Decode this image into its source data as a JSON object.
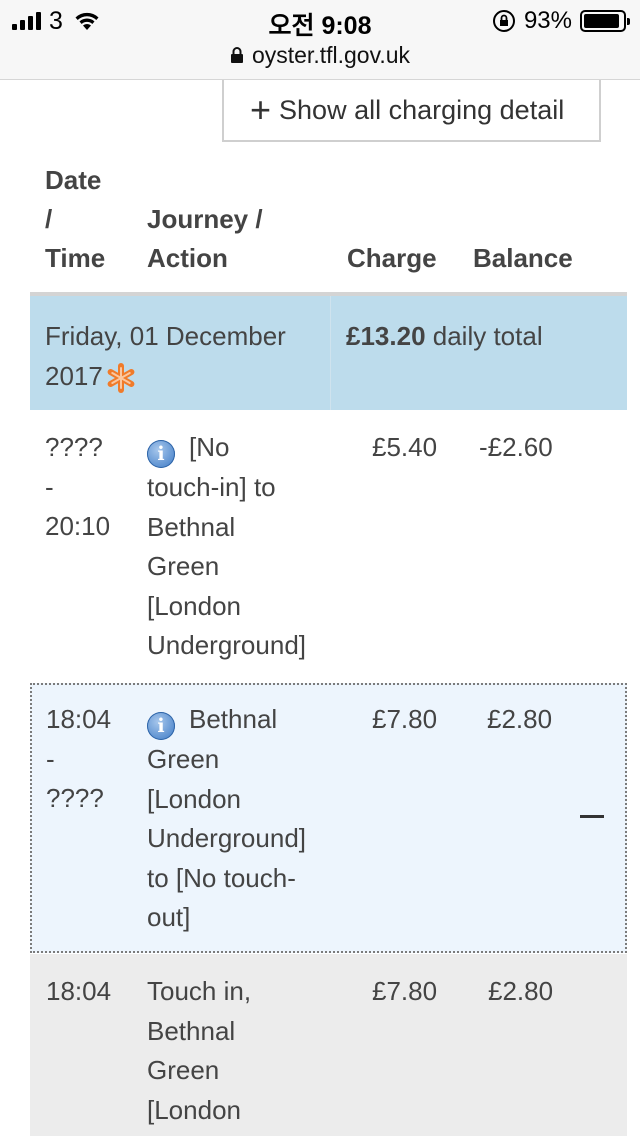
{
  "status_bar": {
    "carrier": "3",
    "time": "오전 9:08",
    "battery_percent": "93%",
    "battery_level": 0.93,
    "url": "oyster.tfl.gov.uk"
  },
  "show_all_button": {
    "label": "Show all charging detail"
  },
  "table_headers": {
    "date_time": [
      "Date",
      "/",
      "Time"
    ],
    "journey": [
      "Journey /",
      "Action"
    ],
    "charge": "Charge",
    "balance": "Balance"
  },
  "day": {
    "date_lines": [
      "Friday, 01 December",
      "2017"
    ],
    "total_amount": "£13.20",
    "total_suffix": " daily total"
  },
  "rows": [
    {
      "time_lines": [
        "????",
        "-",
        "20:10"
      ],
      "journey_lines": [
        "[No",
        "touch-in] to",
        "Bethnal",
        "Green",
        "[London",
        "Underground]"
      ],
      "charge": "£5.40",
      "balance": "-£2.60"
    },
    {
      "time_lines": [
        "18:04",
        "-",
        "????"
      ],
      "journey_lines": [
        "Bethnal",
        "Green",
        "[London",
        "Underground]",
        "to [No touch-",
        "out]"
      ],
      "charge": "£7.80",
      "balance": "£2.80"
    },
    {
      "time_lines": [
        "18:04"
      ],
      "journey_lines": [
        "Touch in,",
        "Bethnal",
        "Green",
        "[London"
      ],
      "charge": "£7.80",
      "balance": "£2.80"
    }
  ]
}
